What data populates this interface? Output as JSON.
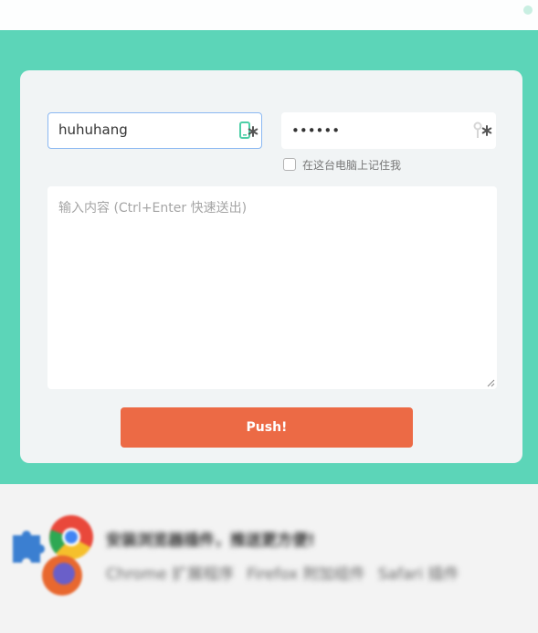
{
  "form": {
    "username_value": "huhuhang",
    "username_icon": "phone-key-icon",
    "password_value": "••••••",
    "password_icon": "key-icon",
    "remember_label": "在这台电脑上记住我",
    "remember_checked": false,
    "content_placeholder": "输入内容 (Ctrl+Enter 快速送出)",
    "push_label": "Push!"
  },
  "promo": {
    "title": "安装浏览器插件，推送更方便!",
    "links": [
      "Chrome 扩展程序",
      "Firefox 附加组件",
      "Safari 插件"
    ]
  },
  "colors": {
    "band": "#5cd5b8",
    "card": "#f1f4f5",
    "push_button": "#ec6a45",
    "username_focus_border": "#8bb8f2",
    "icon_green": "#4ecfa7"
  }
}
